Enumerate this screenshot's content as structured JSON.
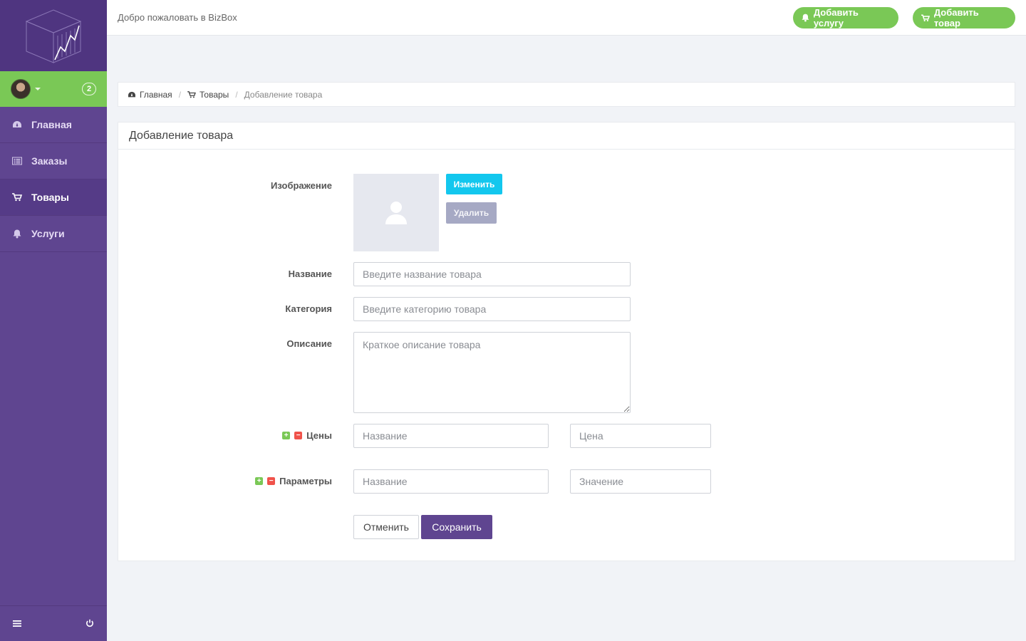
{
  "app": {
    "welcome_text": "Добро пожаловать в BizBox",
    "notification_count": "2"
  },
  "header": {
    "add_service_label": "Добавить услугу",
    "add_product_label": "Добавить товар"
  },
  "sidebar": {
    "items": [
      {
        "label": "Главная",
        "icon": "dashboard-icon"
      },
      {
        "label": "Заказы",
        "icon": "list-icon"
      },
      {
        "label": "Товары",
        "icon": "cart-icon",
        "active": true
      },
      {
        "label": "Услуги",
        "icon": "bell-icon"
      }
    ],
    "bottom": {
      "menu_icon": "menu-icon",
      "power_icon": "power-icon"
    }
  },
  "breadcrumb": {
    "home": "Главная",
    "products": "Товары",
    "current": "Добавление товара"
  },
  "form": {
    "title": "Добавление товара",
    "image_label": "Изображение",
    "change_button": "Изменить",
    "delete_button": "Удалить",
    "name_label": "Название",
    "name_placeholder": "Введите название товара",
    "category_label": "Категория",
    "category_placeholder": "Введите категорию товара",
    "description_label": "Описание",
    "description_placeholder": "Краткое описание товара",
    "prices_label": "Цены",
    "price_name_placeholder": "Название",
    "price_value_placeholder": "Цена",
    "params_label": "Параметры",
    "param_name_placeholder": "Название",
    "param_value_placeholder": "Значение",
    "cancel_button": "Отменить",
    "save_button": "Сохранить"
  },
  "colors": {
    "sidebar": "#5f4590",
    "accent_green": "#7ac856",
    "change_button": "#13c7ee",
    "delete_button": "#a6a9c4",
    "save_button": "#5f4590",
    "remove_red": "#f0524a"
  }
}
